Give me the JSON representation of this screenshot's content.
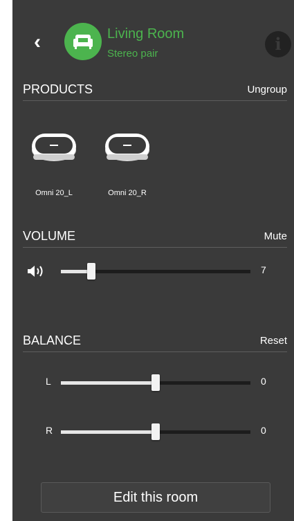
{
  "header": {
    "back_icon": "chevron-left-icon",
    "room_icon": "sofa-icon",
    "room_name": "Living Room",
    "room_subtitle": "Stereo pair",
    "info_icon": "info-icon",
    "accent_color": "#4cb44e"
  },
  "products": {
    "title": "PRODUCTS",
    "action": "Ungroup",
    "items": [
      {
        "label": "Omni 20_L",
        "icon": "speaker-icon"
      },
      {
        "label": "Omni 20_R",
        "icon": "speaker-icon"
      }
    ]
  },
  "volume": {
    "title": "VOLUME",
    "action": "Mute",
    "icon": "speaker-volume-icon",
    "value": "7",
    "level": 0.16
  },
  "balance": {
    "title": "BALANCE",
    "action": "Reset",
    "left": {
      "label": "L",
      "value": "0",
      "level": 0.5
    },
    "right": {
      "label": "R",
      "value": "0",
      "level": 0.5
    }
  },
  "footer": {
    "edit_label": "Edit this room"
  }
}
